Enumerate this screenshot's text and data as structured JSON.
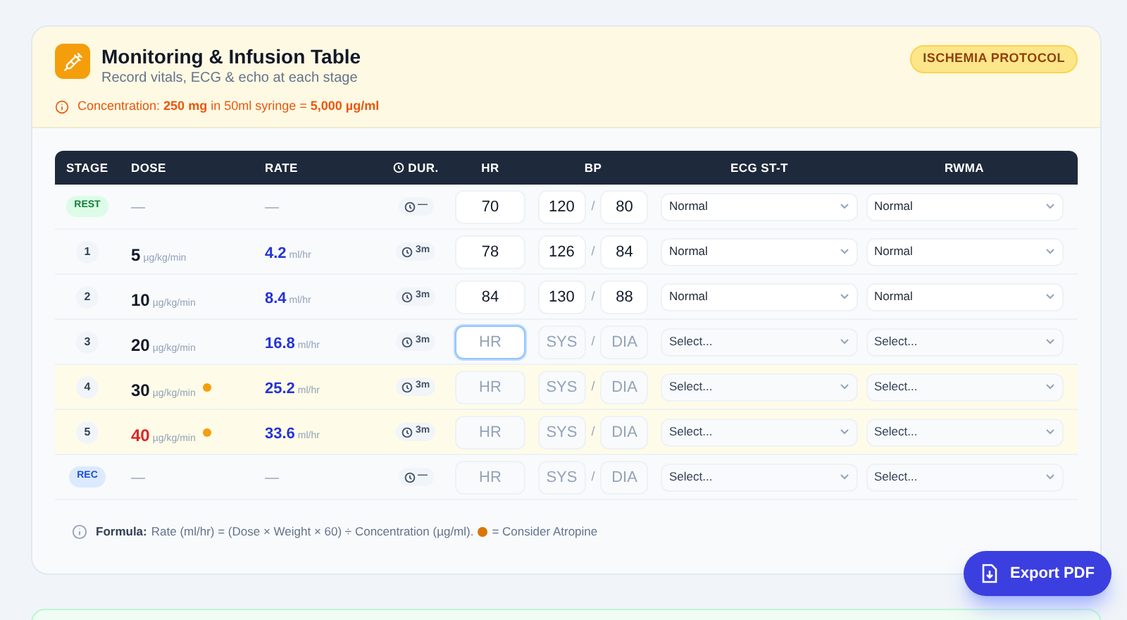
{
  "header": {
    "title": "Monitoring & Infusion Table",
    "subtitle": "Record vitals, ECG & echo at each stage",
    "badge": "ISCHEMIA PROTOCOL",
    "concentration": "Concentration: **250 mg** in 50ml syringe = **5,000 µg/ml**"
  },
  "table": {
    "columns": [
      "STAGE",
      "DOSE",
      "RATE",
      "DUR.",
      "HR",
      "BP",
      "ECG ST-T",
      "RWMA"
    ],
    "rows": [
      {
        "stage": "REST",
        "kind": "rest",
        "dose": "—",
        "rate": "—",
        "duration": "—",
        "highlighted": false,
        "hr": {
          "value": "70",
          "focused": false
        },
        "sys": {
          "value": "120"
        },
        "dia": {
          "value": "80"
        },
        "separator": "/",
        "ecg": {
          "value": "Normal",
          "filled": true
        },
        "rwma": {
          "value": "Normal",
          "filled": true
        }
      },
      {
        "stage": "1",
        "kind": "number",
        "dose": "5",
        "dose_unit": "µg/kg/min",
        "high": false,
        "atropine": false,
        "rate": "4.2",
        "rate_unit": "ml/hr",
        "duration": "3m",
        "highlighted": false,
        "hr": {
          "value": "78",
          "focused": false
        },
        "sys": {
          "value": "126"
        },
        "dia": {
          "value": "84"
        },
        "separator": "/",
        "ecg": {
          "value": "Normal",
          "filled": true
        },
        "rwma": {
          "value": "Normal",
          "filled": true
        }
      },
      {
        "stage": "2",
        "kind": "number",
        "dose": "10",
        "dose_unit": "µg/kg/min",
        "high": false,
        "atropine": false,
        "rate": "8.4",
        "rate_unit": "ml/hr",
        "duration": "3m",
        "highlighted": false,
        "hr": {
          "value": "84",
          "focused": false
        },
        "sys": {
          "value": "130"
        },
        "dia": {
          "value": "88"
        },
        "separator": "/",
        "ecg": {
          "value": "Normal",
          "filled": true
        },
        "rwma": {
          "value": "Normal",
          "filled": true
        }
      },
      {
        "stage": "3",
        "kind": "number",
        "dose": "20",
        "dose_unit": "µg/kg/min",
        "high": false,
        "atropine": false,
        "rate": "16.8",
        "rate_unit": "ml/hr",
        "duration": "3m",
        "highlighted": false,
        "hr": {
          "placeholder": "HR",
          "focused": true
        },
        "sys": {
          "placeholder": "SYS"
        },
        "dia": {
          "placeholder": "DIA"
        },
        "separator": "/",
        "ecg": {
          "value": "Select...",
          "filled": false
        },
        "rwma": {
          "value": "Select...",
          "filled": false
        }
      },
      {
        "stage": "4",
        "kind": "number",
        "dose": "30",
        "dose_unit": "µg/kg/min",
        "high": false,
        "atropine": true,
        "rate": "25.2",
        "rate_unit": "ml/hr",
        "duration": "3m",
        "highlighted": true,
        "hr": {
          "placeholder": "HR",
          "focused": false
        },
        "sys": {
          "placeholder": "SYS"
        },
        "dia": {
          "placeholder": "DIA"
        },
        "separator": "/",
        "ecg": {
          "value": "Select...",
          "filled": false
        },
        "rwma": {
          "value": "Select...",
          "filled": false
        }
      },
      {
        "stage": "5",
        "kind": "number",
        "dose": "40",
        "dose_unit": "µg/kg/min",
        "high": true,
        "atropine": true,
        "rate": "33.6",
        "rate_unit": "ml/hr",
        "duration": "3m",
        "highlighted": true,
        "hr": {
          "placeholder": "HR",
          "focused": false
        },
        "sys": {
          "placeholder": "SYS"
        },
        "dia": {
          "placeholder": "DIA"
        },
        "separator": "/",
        "ecg": {
          "value": "Select...",
          "filled": false
        },
        "rwma": {
          "value": "Select...",
          "filled": false
        }
      },
      {
        "stage": "REC",
        "kind": "rec",
        "dose": "—",
        "rate": "—",
        "duration": "—",
        "highlighted": false,
        "hr": {
          "placeholder": "HR",
          "focused": false
        },
        "sys": {
          "placeholder": "SYS"
        },
        "dia": {
          "placeholder": "DIA"
        },
        "separator": "/",
        "ecg": {
          "value": "Select...",
          "filled": false
        },
        "rwma": {
          "value": "Select...",
          "filled": false
        }
      }
    ]
  },
  "footer": {
    "formula_label": "Formula:",
    "formula": "Rate (ml/hr) = (Dose × Weight × 60) ÷ Concentration (µg/ml).",
    "legend": "= Consider Atropine"
  },
  "export_button": "Export PDF"
}
